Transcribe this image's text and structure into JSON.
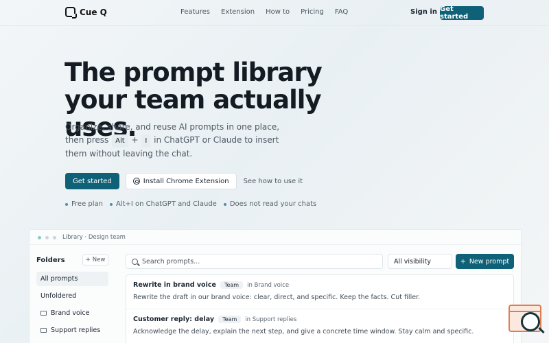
{
  "brand": {
    "name": "Cue Q"
  },
  "nav": {
    "links": [
      "Features",
      "Extension",
      "How to",
      "Pricing",
      "FAQ"
    ],
    "sign_in": "Sign in",
    "get_started": "Get started"
  },
  "hero": {
    "headline": "The prompt library your team actually uses.",
    "subtext_before": "Organize, share, and reuse AI prompts in one place, then press",
    "key1": "Alt",
    "plus": "+",
    "key2": "I",
    "subtext_after": "in ChatGPT or Claude to insert them without leaving the chat.",
    "cta_primary": "Get started",
    "cta_extension": "Install Chrome Extension",
    "cta_link": "See how to use it",
    "features": [
      "Free plan",
      "Alt+I on ChatGPT and Claude",
      "Does not read your chats"
    ]
  },
  "app": {
    "breadcrumb": "Library · Design team",
    "folders_title": "Folders",
    "new_folder": "New",
    "folders": [
      {
        "label": "All prompts",
        "active": true,
        "icon": ""
      },
      {
        "label": "Unfoldered",
        "active": false,
        "icon": ""
      },
      {
        "label": "Brand voice",
        "active": false,
        "icon": "folder-icon"
      },
      {
        "label": "Support replies",
        "active": false,
        "icon": "folder-icon"
      }
    ],
    "search_placeholder": "Search prompts...",
    "visibility": "All visibility",
    "new_prompt": "New prompt",
    "prompts": [
      {
        "title": "Rewrite in brand voice",
        "badge": "Team",
        "folder": "in Brand voice",
        "desc": "Rewrite the draft in our brand voice: clear, direct, and specific. Keep the facts. Cut filler."
      },
      {
        "title": "Customer reply: delay",
        "badge": "Team",
        "folder": "in Support replies",
        "desc": "Acknowledge the delay, explain the next step, and give a concrete time window. Stay calm and specific."
      }
    ]
  },
  "colors": {
    "primary": "#0f6178",
    "accent_dot": "#4f8ea0",
    "widget_orange": "#e07d4f"
  }
}
